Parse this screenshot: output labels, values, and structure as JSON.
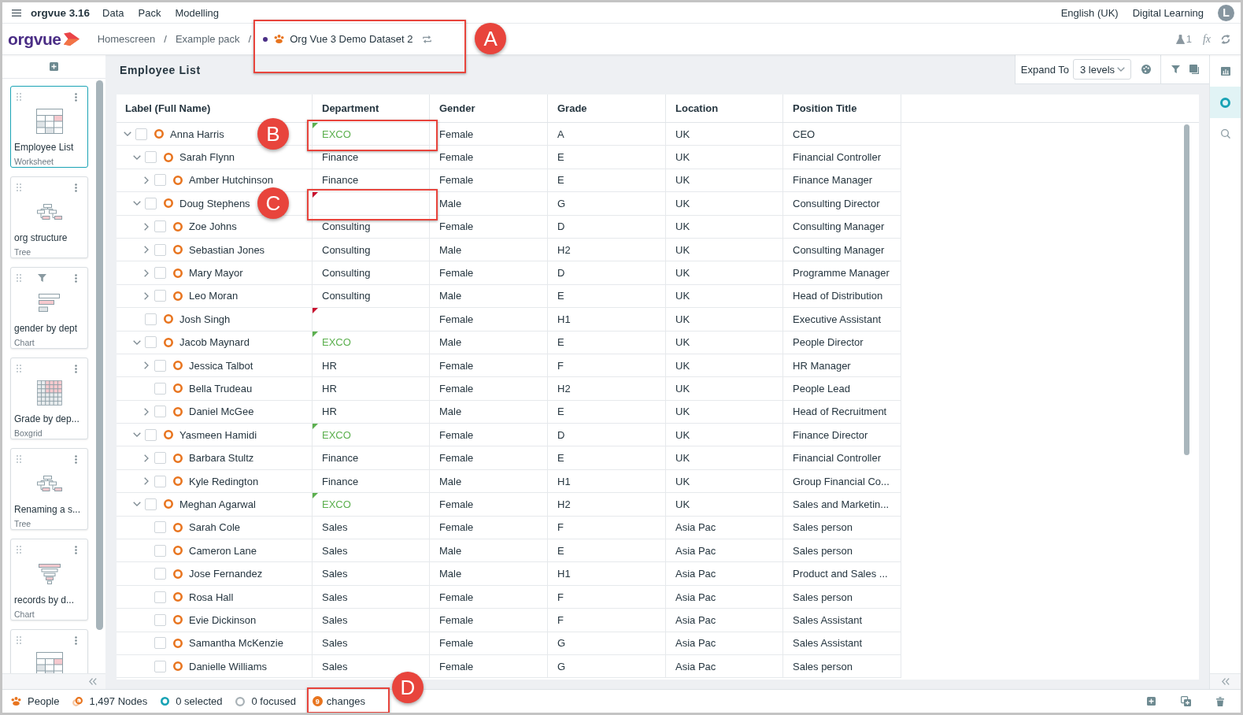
{
  "menu_bar": {
    "app_name": "orgvue 3.16",
    "menus": [
      "Data",
      "Pack",
      "Modelling"
    ],
    "language": "English (UK)",
    "user_name": "Digital Learning",
    "avatar_initial": "L"
  },
  "nav_bar": {
    "logo_text": "orgvue",
    "breadcrumbs": [
      {
        "kind": "link",
        "label": "Homescreen",
        "separator": "/"
      },
      {
        "kind": "link",
        "label": "Example pack",
        "separator": "/"
      },
      {
        "kind": "dataset",
        "label": "Org Vue 3 Demo Dataset 2",
        "unsaved": true,
        "callout": "A"
      }
    ],
    "experiment_count": "1",
    "formula_label": "fx"
  },
  "sidebar": {
    "cards": [
      {
        "kind": "worksheet",
        "title": "Employee List",
        "view_type": "Worksheet",
        "selected": true,
        "filtered": false
      },
      {
        "kind": "tree",
        "title": "org structure",
        "view_type": "Tree",
        "selected": false,
        "filtered": false
      },
      {
        "kind": "bar-chart",
        "title": "gender by dept",
        "view_type": "Chart",
        "selected": false,
        "filtered": true
      },
      {
        "kind": "boxgrid",
        "title": "Grade by dep...",
        "view_type": "Boxgrid",
        "selected": false,
        "filtered": false
      },
      {
        "kind": "tree",
        "title": "Renaming a s...",
        "view_type": "Tree",
        "selected": false,
        "filtered": false
      },
      {
        "kind": "funnel-chart",
        "title": "records by d...",
        "view_type": "Chart",
        "selected": false,
        "filtered": false
      },
      {
        "kind": "worksheet",
        "selected": false,
        "filtered": false
      }
    ]
  },
  "view": {
    "title": "Employee List",
    "expand_label": "Expand To",
    "expand_value": "3 levels"
  },
  "table": {
    "columns": [
      "Label (Full Name)",
      "Department",
      "Gender",
      "Grade",
      "Location",
      "Position Title"
    ],
    "rows": [
      {
        "label": "Anna Harris",
        "expanded": true,
        "checked": false,
        "department": "EXCO",
        "department_flag": {
          "color": "#5cb04f"
        },
        "gender": "Female",
        "grade": "A",
        "location": "UK",
        "position_title": "CEO",
        "callout": "B",
        "children": [
          {
            "label": "Sarah Flynn",
            "expanded": true,
            "checked": false,
            "department": "Finance",
            "gender": "Female",
            "grade": "E",
            "location": "UK",
            "position_title": "Financial Controller",
            "children": [
              {
                "label": "Amber Hutchinson",
                "expanded": false,
                "checked": false,
                "department": "Finance",
                "gender": "Female",
                "grade": "E",
                "location": "UK",
                "position_title": "Finance Manager"
              }
            ]
          },
          {
            "label": "Doug Stephens",
            "expanded": true,
            "checked": false,
            "department_flag": {
              "color": "#c8102e"
            },
            "gender": "Male",
            "grade": "G",
            "location": "UK",
            "position_title": "Consulting Director",
            "callout": "C",
            "children": [
              {
                "label": "Zoe Johns",
                "expanded": false,
                "checked": false,
                "department": "Consulting",
                "gender": "Female",
                "grade": "D",
                "location": "UK",
                "position_title": "Consulting Manager"
              },
              {
                "label": "Sebastian Jones",
                "expanded": false,
                "checked": false,
                "department": "Consulting",
                "gender": "Male",
                "grade": "H2",
                "location": "UK",
                "position_title": "Consulting Manager"
              },
              {
                "label": "Mary Mayor",
                "expanded": false,
                "checked": false,
                "department": "Consulting",
                "gender": "Female",
                "grade": "D",
                "location": "UK",
                "position_title": "Programme Manager"
              },
              {
                "label": "Leo Moran",
                "expanded": false,
                "checked": false,
                "department": "Consulting",
                "gender": "Male",
                "grade": "E",
                "location": "UK",
                "position_title": "Head of Distribution"
              }
            ]
          },
          {
            "label": "Josh Singh",
            "checked": false,
            "department_flag": {
              "color": "#c8102e"
            },
            "gender": "Female",
            "grade": "H1",
            "location": "UK",
            "position_title": "Executive Assistant"
          },
          {
            "label": "Jacob Maynard",
            "expanded": true,
            "checked": false,
            "department": "EXCO",
            "department_flag": {
              "color": "#5cb04f"
            },
            "gender": "Male",
            "grade": "E",
            "location": "UK",
            "position_title": "People Director",
            "children": [
              {
                "label": "Jessica Talbot",
                "expanded": false,
                "checked": false,
                "department": "HR",
                "gender": "Female",
                "grade": "F",
                "location": "UK",
                "position_title": "HR Manager"
              },
              {
                "label": "Bella Trudeau",
                "checked": false,
                "department": "HR",
                "gender": "Female",
                "grade": "H2",
                "location": "UK",
                "position_title": "People Lead"
              },
              {
                "label": "Daniel McGee",
                "expanded": false,
                "checked": false,
                "department": "HR",
                "gender": "Male",
                "grade": "E",
                "location": "UK",
                "position_title": "Head of Recruitment"
              }
            ]
          },
          {
            "label": "Yasmeen Hamidi",
            "expanded": true,
            "checked": false,
            "department": "EXCO",
            "department_flag": {
              "color": "#5cb04f"
            },
            "gender": "Female",
            "grade": "D",
            "location": "UK",
            "position_title": "Finance Director",
            "children": [
              {
                "label": "Barbara Stultz",
                "expanded": false,
                "checked": false,
                "department": "Finance",
                "gender": "Female",
                "grade": "E",
                "location": "UK",
                "position_title": "Financial Controller"
              },
              {
                "label": "Kyle Redington",
                "expanded": false,
                "checked": false,
                "department": "Finance",
                "gender": "Male",
                "grade": "H1",
                "location": "UK",
                "position_title": "Group Financial Co..."
              }
            ]
          },
          {
            "label": "Meghan Agarwal",
            "expanded": true,
            "checked": false,
            "department": "EXCO",
            "department_flag": {
              "color": "#5cb04f"
            },
            "gender": "Female",
            "grade": "H2",
            "location": "UK",
            "position_title": "Sales and Marketin...",
            "children": [
              {
                "label": "Sarah Cole",
                "checked": false,
                "department": "Sales",
                "gender": "Female",
                "grade": "F",
                "location": "Asia Pac",
                "position_title": "Sales person"
              },
              {
                "label": "Cameron Lane",
                "checked": false,
                "department": "Sales",
                "gender": "Male",
                "grade": "E",
                "location": "Asia Pac",
                "position_title": "Sales person"
              },
              {
                "label": "Jose Fernandez",
                "checked": false,
                "department": "Sales",
                "gender": "Male",
                "grade": "H1",
                "location": "Asia Pac",
                "position_title": "Product and Sales ..."
              },
              {
                "label": "Rosa Hall",
                "checked": false,
                "department": "Sales",
                "gender": "Female",
                "grade": "F",
                "location": "Asia Pac",
                "position_title": "Sales person"
              },
              {
                "label": "Evie Dickinson",
                "checked": false,
                "department": "Sales",
                "gender": "Female",
                "grade": "F",
                "location": "Asia Pac",
                "position_title": "Sales Assistant"
              },
              {
                "label": "Samantha McKenzie",
                "checked": false,
                "department": "Sales",
                "gender": "Female",
                "grade": "G",
                "location": "Asia Pac",
                "position_title": "Sales Assistant"
              },
              {
                "label": "Danielle Williams",
                "checked": false,
                "department": "Sales",
                "gender": "Female",
                "grade": "G",
                "location": "Asia Pac",
                "position_title": "Sales person"
              }
            ]
          }
        ]
      }
    ]
  },
  "right_rail": {
    "items": [
      {
        "kind": "chart",
        "selected": false
      },
      {
        "kind": "nodes",
        "selected": true
      },
      {
        "kind": "search",
        "selected": false
      }
    ]
  },
  "status_bar": {
    "dataset_label": "People",
    "nodes": "1,497 Nodes",
    "selected": "0 selected",
    "focused": "0 focused",
    "changes_count": "9",
    "changes_label": "changes",
    "callout": "D"
  }
}
